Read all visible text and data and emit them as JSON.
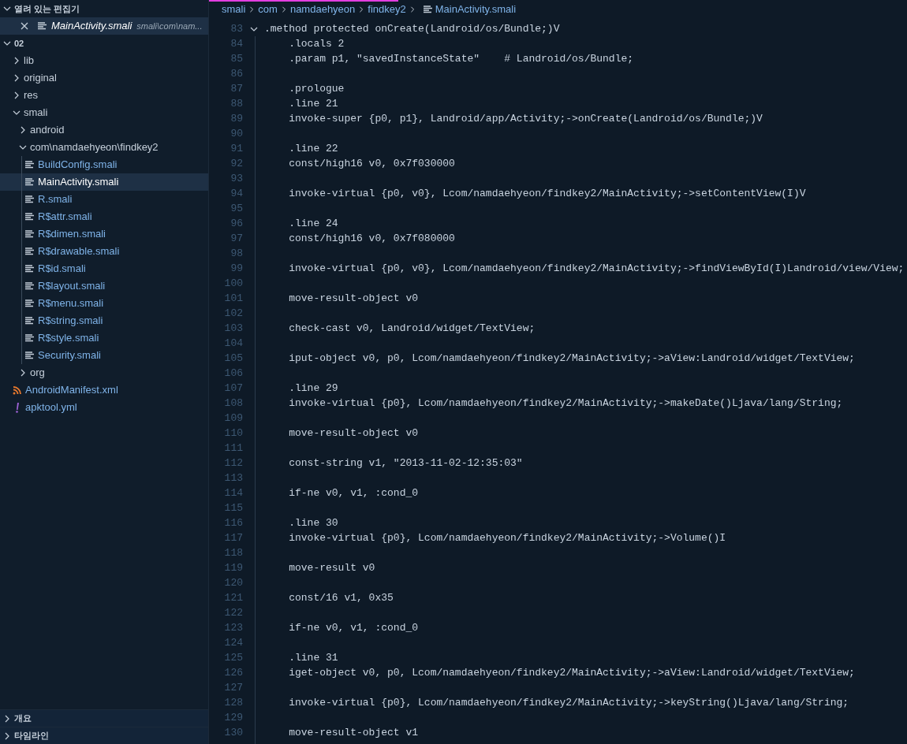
{
  "sidebar": {
    "open_editors": {
      "title": "열려 있는 편집기",
      "expanded": true,
      "items": [
        {
          "name": "MainActivity.smali",
          "path": "smali\\com\\nam...",
          "selected": true
        }
      ]
    },
    "explorer": {
      "title": "02",
      "expanded": true,
      "children": [
        {
          "kind": "folder",
          "name": "lib",
          "expanded": false
        },
        {
          "kind": "folder",
          "name": "original",
          "expanded": false
        },
        {
          "kind": "folder",
          "name": "res",
          "expanded": false
        },
        {
          "kind": "folder",
          "name": "smali",
          "expanded": true,
          "children": [
            {
              "kind": "folder",
              "name": "android",
              "expanded": false
            },
            {
              "kind": "folder",
              "name": "com\\namdaehyeon\\findkey2",
              "expanded": true,
              "children": [
                {
                  "kind": "smali",
                  "name": "BuildConfig.smali",
                  "selected": false
                },
                {
                  "kind": "smali",
                  "name": "MainActivity.smali",
                  "selected": true
                },
                {
                  "kind": "smali",
                  "name": "R.smali",
                  "selected": false
                },
                {
                  "kind": "smali",
                  "name": "R$attr.smali",
                  "selected": false
                },
                {
                  "kind": "smali",
                  "name": "R$dimen.smali",
                  "selected": false
                },
                {
                  "kind": "smali",
                  "name": "R$drawable.smali",
                  "selected": false
                },
                {
                  "kind": "smali",
                  "name": "R$id.smali",
                  "selected": false
                },
                {
                  "kind": "smali",
                  "name": "R$layout.smali",
                  "selected": false
                },
                {
                  "kind": "smali",
                  "name": "R$menu.smali",
                  "selected": false
                },
                {
                  "kind": "smali",
                  "name": "R$string.smali",
                  "selected": false
                },
                {
                  "kind": "smali",
                  "name": "R$style.smali",
                  "selected": false
                },
                {
                  "kind": "smali",
                  "name": "Security.smali",
                  "selected": false
                }
              ]
            },
            {
              "kind": "folder",
              "name": "org",
              "expanded": false
            }
          ]
        },
        {
          "kind": "xml",
          "name": "AndroidManifest.xml",
          "selected": false
        },
        {
          "kind": "yml",
          "name": "apktool.yml",
          "selected": false
        }
      ]
    },
    "panels": [
      {
        "title": "개요",
        "expanded": false
      },
      {
        "title": "타임라인",
        "expanded": false
      }
    ]
  },
  "breadcrumb": [
    {
      "kind": "folder",
      "label": "smali"
    },
    {
      "kind": "folder",
      "label": "com"
    },
    {
      "kind": "folder",
      "label": "namdaehyeon"
    },
    {
      "kind": "folder",
      "label": "findkey2"
    },
    {
      "kind": "smali",
      "label": "MainActivity.smali"
    }
  ],
  "code": {
    "lines": [
      {
        "number": "83",
        "text": ".method protected onCreate(Landroid/os/Bundle;)V",
        "expanded": true
      },
      {
        "number": "84",
        "text": "    .locals 2"
      },
      {
        "number": "85",
        "text": "    .param p1, \"savedInstanceState\"    # Landroid/os/Bundle;"
      },
      {
        "number": "86"
      },
      {
        "number": "87",
        "text": "    .prologue"
      },
      {
        "number": "88",
        "text": "    .line 21"
      },
      {
        "number": "89",
        "text": "    invoke-super {p0, p1}, Landroid/app/Activity;->onCreate(Landroid/os/Bundle;)V"
      },
      {
        "number": "90"
      },
      {
        "number": "91",
        "text": "    .line 22"
      },
      {
        "number": "92",
        "text": "    const/high16 v0, 0x7f030000"
      },
      {
        "number": "93"
      },
      {
        "number": "94",
        "text": "    invoke-virtual {p0, v0}, Lcom/namdaehyeon/findkey2/MainActivity;->setContentView(I)V"
      },
      {
        "number": "95"
      },
      {
        "number": "96",
        "text": "    .line 24"
      },
      {
        "number": "97",
        "text": "    const/high16 v0, 0x7f080000"
      },
      {
        "number": "98"
      },
      {
        "number": "99",
        "text": "    invoke-virtual {p0, v0}, Lcom/namdaehyeon/findkey2/MainActivity;->findViewById(I)Landroid/view/View;"
      },
      {
        "number": "100"
      },
      {
        "number": "101",
        "text": "    move-result-object v0"
      },
      {
        "number": "102"
      },
      {
        "number": "103",
        "text": "    check-cast v0, Landroid/widget/TextView;"
      },
      {
        "number": "104"
      },
      {
        "number": "105",
        "text": "    iput-object v0, p0, Lcom/namdaehyeon/findkey2/MainActivity;->aView:Landroid/widget/TextView;"
      },
      {
        "number": "106"
      },
      {
        "number": "107",
        "text": "    .line 29"
      },
      {
        "number": "108",
        "text": "    invoke-virtual {p0}, Lcom/namdaehyeon/findkey2/MainActivity;->makeDate()Ljava/lang/String;"
      },
      {
        "number": "109"
      },
      {
        "number": "110",
        "text": "    move-result-object v0"
      },
      {
        "number": "111"
      },
      {
        "number": "112",
        "text": "    const-string v1, \"2013-11-02-12:35:03\""
      },
      {
        "number": "113"
      },
      {
        "number": "114",
        "text": "    if-ne v0, v1, :cond_0"
      },
      {
        "number": "115"
      },
      {
        "number": "116",
        "text": "    .line 30"
      },
      {
        "number": "117",
        "text": "    invoke-virtual {p0}, Lcom/namdaehyeon/findkey2/MainActivity;->Volume()I"
      },
      {
        "number": "118"
      },
      {
        "number": "119",
        "text": "    move-result v0"
      },
      {
        "number": "120"
      },
      {
        "number": "121",
        "text": "    const/16 v1, 0x35"
      },
      {
        "number": "122"
      },
      {
        "number": "123",
        "text": "    if-ne v0, v1, :cond_0"
      },
      {
        "number": "124"
      },
      {
        "number": "125",
        "text": "    .line 31"
      },
      {
        "number": "126",
        "text": "    iget-object v0, p0, Lcom/namdaehyeon/findkey2/MainActivity;->aView:Landroid/widget/TextView;"
      },
      {
        "number": "127"
      },
      {
        "number": "128",
        "text": "    invoke-virtual {p0}, Lcom/namdaehyeon/findkey2/MainActivity;->keyString()Ljava/lang/String;"
      },
      {
        "number": "129"
      },
      {
        "number": "130",
        "text": "    move-result-object v1"
      }
    ]
  }
}
